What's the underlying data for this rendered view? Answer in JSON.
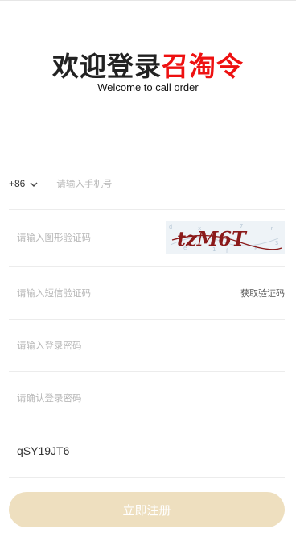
{
  "brand": {
    "title_dark": "欢迎登录",
    "title_red": "召淘令",
    "subtitle": "Welcome to call order"
  },
  "form": {
    "country_code": "+86",
    "phone_placeholder": "请输入手机号",
    "captcha_placeholder": "请输入图形验证码",
    "captcha_text": "tzM6T",
    "sms_placeholder": "请输入短信验证码",
    "sms_button": "获取验证码",
    "password_placeholder": "请输入登录密码",
    "confirm_placeholder": "请确认登录密码",
    "invite_value": "qSY19JT6",
    "submit_label": "立即注册"
  },
  "colors": {
    "brand_red": "#ee1111",
    "submit_bg": "#eedfbf",
    "captcha_ink": "#8b1a1a"
  }
}
